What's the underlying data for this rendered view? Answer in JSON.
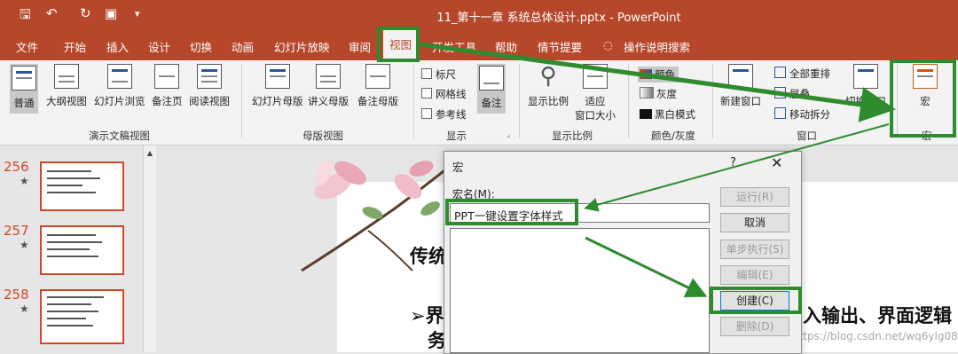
{
  "titlebar": {
    "title": "11_第十一章 系统总体设计.pptx  -  PowerPoint",
    "qat": [
      "save-icon",
      "undo-icon",
      "redo-icon",
      "present-icon",
      "customize-icon"
    ]
  },
  "tabs": [
    "文件",
    "开始",
    "插入",
    "设计",
    "切换",
    "动画",
    "幻灯片放映",
    "审阅",
    "视图",
    "开发工具",
    "帮助",
    "情节提要",
    "操作说明搜索"
  ],
  "ribbon": {
    "presentation_views": {
      "label": "演示文稿视图",
      "buttons": [
        "普通",
        "大纲视图",
        "幻灯片浏览",
        "备注页",
        "阅读视图"
      ]
    },
    "master_views": {
      "label": "母版视图",
      "buttons": [
        "幻灯片母版",
        "讲义母版",
        "备注母版"
      ]
    },
    "show": {
      "label": "显示",
      "checks": [
        "标尺",
        "网格线",
        "参考线"
      ],
      "notes": "备注"
    },
    "zoom": {
      "label": "显示比例",
      "zoom_btn": "显示比例",
      "fit_line1": "适应",
      "fit_line2": "窗口大小"
    },
    "color": {
      "label": "颜色/灰度",
      "items": [
        "颜色",
        "灰度",
        "黑白模式"
      ]
    },
    "window": {
      "label": "窗口",
      "new_window": "新建窗口",
      "arrange_all": "全部重排",
      "cascade": "层叠",
      "move_split": "移动拆分",
      "switch_window": "切换窗口"
    },
    "macros": {
      "label": "宏",
      "button": "宏"
    }
  },
  "slides": [
    {
      "num": "256",
      "mark": "★"
    },
    {
      "num": "257",
      "mark": "★"
    },
    {
      "num": "258",
      "mark": "★"
    }
  ],
  "slide_content": {
    "heading": "传统",
    "bullet_part1": "界",
    "bullet_part2": "务",
    "bullet_right": "入输出、界面逻辑",
    "watermark": "https://blog.csdn.net/wq6ylg08"
  },
  "dialog": {
    "title": "宏",
    "help": "?",
    "close": "✕",
    "macro_name_label": "宏名(M):",
    "macro_name_value": "PPT一键设置字体样式",
    "buttons": [
      "运行(R)",
      "取消",
      "单步执行(S)",
      "编辑(E)",
      "创建(C)",
      "删除(D)"
    ]
  },
  "colors": {
    "titlebar": "#b7472a",
    "highlight": "#2e8b2e"
  }
}
